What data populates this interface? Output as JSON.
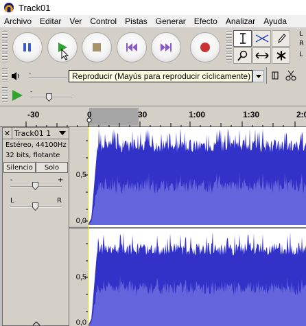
{
  "window": {
    "title": "Track01"
  },
  "menu": [
    "Archivo",
    "Editar",
    "Ver",
    "Control",
    "Pistas",
    "Generar",
    "Efecto",
    "Analizar",
    "Ayuda"
  ],
  "transport": {
    "pause": "pause-icon",
    "play": "play-icon",
    "stop": "stop-icon",
    "skip_start": "skip-to-start-icon",
    "skip_end": "skip-to-end-icon",
    "record": "record-icon"
  },
  "meters": {
    "left_label": "L",
    "right_label": "R"
  },
  "tooltip": {
    "text": "Reproducir (Mayús para reproducir cíclicamente)"
  },
  "ruler": {
    "labels": [
      "-30",
      "0",
      "30",
      "1:00",
      "1:30",
      "2:0"
    ]
  },
  "track": {
    "name": "Track01 1",
    "format": "Estéreo, 44100Hz",
    "depth": "32 bits, flotante",
    "mute": "Silencio",
    "solo": "Solo",
    "gain_minus": "-",
    "gain_plus": "+",
    "pan_left": "L",
    "pan_right": "R",
    "scale_top": [
      "0,5",
      "0,0"
    ],
    "scale_bottom": [
      "0,5",
      "0,0"
    ]
  },
  "colors": {
    "wave_peak": "#3232c8",
    "wave_rms": "#6464dc",
    "selection": "#a6a6a6"
  }
}
